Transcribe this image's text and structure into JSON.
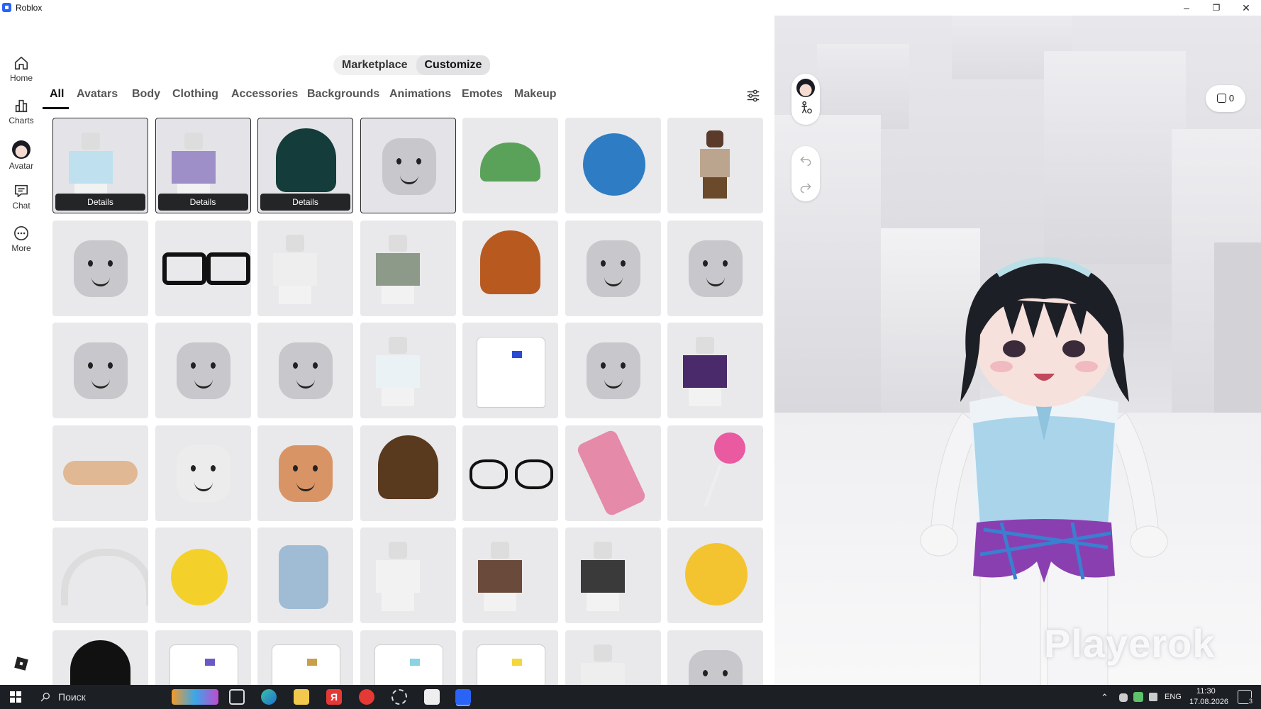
{
  "window": {
    "title": "Roblox",
    "controls": [
      "–",
      "❐",
      "✕"
    ]
  },
  "nav": [
    {
      "label": "Home",
      "icon": "home-icon"
    },
    {
      "label": "Charts",
      "icon": "chart-icon"
    },
    {
      "label": "Avatar",
      "icon": "avatar-icon"
    },
    {
      "label": "Chat",
      "icon": "chat-icon"
    },
    {
      "label": "More",
      "icon": "more-icon"
    }
  ],
  "mode_toggle": {
    "marketplace": "Marketplace",
    "customize": "Customize",
    "selected": "Customize"
  },
  "tabs": [
    "All",
    "Avatars",
    "Body",
    "Clothing",
    "Accessories",
    "Backgrounds",
    "Animations",
    "Emotes",
    "Makeup"
  ],
  "active_tab": "All",
  "details_label": "Details",
  "items": [
    {
      "kind": "outfit-blue",
      "selected": true,
      "details": true
    },
    {
      "kind": "outfit-purple",
      "selected": true,
      "details": true
    },
    {
      "kind": "hair-black",
      "selected": true,
      "details": true
    },
    {
      "kind": "face-anime",
      "selected": true,
      "details": false
    },
    {
      "kind": "cap-green"
    },
    {
      "kind": "badge-20"
    },
    {
      "kind": "avatar-brown"
    },
    {
      "kind": "face-freckles"
    },
    {
      "kind": "glasses-black"
    },
    {
      "kind": "outfit-black-pants"
    },
    {
      "kind": "outfit-grey"
    },
    {
      "kind": "hair-orange"
    },
    {
      "kind": "face-smile"
    },
    {
      "kind": "face-surprised"
    },
    {
      "kind": "face-smirk"
    },
    {
      "kind": "face-sly"
    },
    {
      "kind": "face-classic"
    },
    {
      "kind": "outfit-white"
    },
    {
      "kind": "tshirt-flag"
    },
    {
      "kind": "face-crying"
    },
    {
      "kind": "outfit-purple-top"
    },
    {
      "kind": "bandage"
    },
    {
      "kind": "face-sleepy"
    },
    {
      "kind": "face-lips"
    },
    {
      "kind": "hair-brown"
    },
    {
      "kind": "glasses-round"
    },
    {
      "kind": "phone-flip"
    },
    {
      "kind": "lollipop"
    },
    {
      "kind": "headband-cat"
    },
    {
      "kind": "duck"
    },
    {
      "kind": "scarf-blue"
    },
    {
      "kind": "outfit-sketch"
    },
    {
      "kind": "outfit-brown"
    },
    {
      "kind": "outfit-plaid"
    },
    {
      "kind": "emoji-flushed"
    },
    {
      "kind": "hair-black-2"
    },
    {
      "kind": "tshirt-cat"
    },
    {
      "kind": "tshirt-homer"
    },
    {
      "kind": "tshirt-stripes"
    },
    {
      "kind": "tshirt-emoji"
    },
    {
      "kind": "outfit-white-2"
    },
    {
      "kind": "face-plain"
    }
  ],
  "preview": {
    "robux": "0",
    "watermark": "Playerok"
  },
  "taskbar": {
    "search_placeholder": "Поиск",
    "lang": "ENG",
    "time": "11:30",
    "date": "17.08.2026",
    "notifications": "3"
  },
  "colors": {
    "accent": "#2a64f6",
    "taskbar": "#1c1f24"
  }
}
